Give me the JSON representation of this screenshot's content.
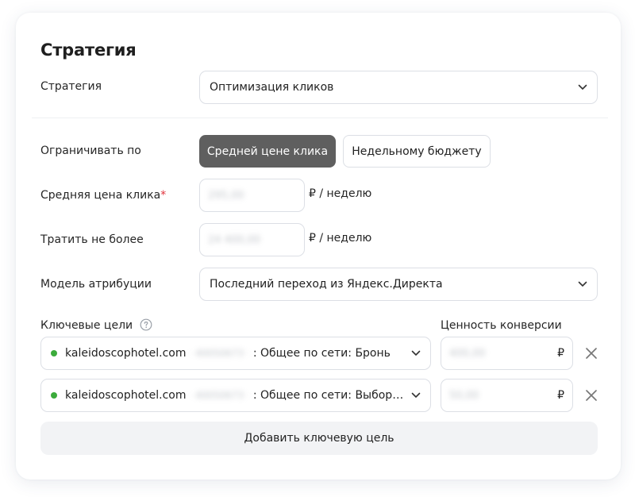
{
  "section": {
    "title": "Стратегия"
  },
  "strategy": {
    "label": "Стратегия",
    "value": "Оптимизация кликов"
  },
  "limit": {
    "label": "Ограничивать по",
    "options": [
      "Средней цене клика",
      "Недельному бюджету"
    ],
    "selected": "Средней цене клика"
  },
  "avg_cpc": {
    "label": "Средняя цена клика",
    "required_mark": "*",
    "value": "295,00",
    "unit": "₽ / неделю"
  },
  "spend_limit": {
    "label": "Тратить не более",
    "value": "24 400,00",
    "unit": "₽ / неделю"
  },
  "attribution": {
    "label": "Модель атрибуции",
    "value": "Последний переход из Яндекс.Директа"
  },
  "goals": {
    "label": "Ключевые цели",
    "value_header": "Ценность конверсии",
    "items": [
      {
        "site": "kaleidoscophotel.com",
        "goal_id": "· 40050673 ·",
        "goal_name": ": Общее по сети: Бронь",
        "status_color": "#3bab3b",
        "value": "400,00",
        "currency": "₽"
      },
      {
        "site": "kaleidoscophotel.com",
        "goal_id": "· 40050673 ·",
        "goal_name": ": Общее по сети: Выбор номера",
        "status_color": "#3bab3b",
        "value": "50,00",
        "currency": "₽"
      }
    ],
    "add_label": "Добавить ключевую цель"
  },
  "colors": {
    "accent_selected": "#5f5f5f",
    "border": "#dcdfe5",
    "required": "#e0323c",
    "status_ok": "#3bab3b"
  }
}
